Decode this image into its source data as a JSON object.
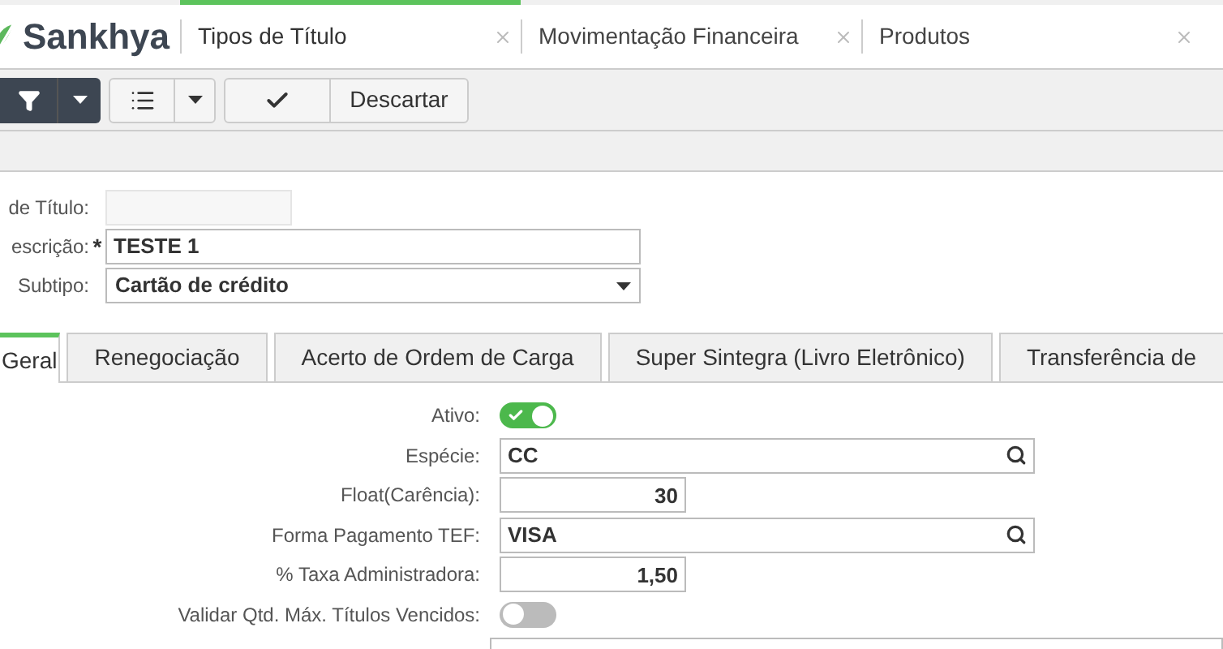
{
  "brand": "Sankhya",
  "tabs": [
    {
      "label": "Tipos de Título",
      "selected": true
    },
    {
      "label": "Movimentação Financeira",
      "selected": false
    },
    {
      "label": "Produtos",
      "selected": false
    }
  ],
  "toolbar": {
    "discard": "Descartar"
  },
  "header_fields": [
    {
      "label": "de Título:",
      "kind": "readonly"
    },
    {
      "label": "escrição:",
      "kind": "text",
      "value": "TESTE 1",
      "required_mark": "*"
    },
    {
      "label": "Subtipo:",
      "kind": "select",
      "value": "Cartão de crédito"
    }
  ],
  "form_tabs": [
    {
      "label": "Geral",
      "selected": true
    },
    {
      "label": "Renegociação",
      "selected": false
    },
    {
      "label": "Acerto de Ordem de Carga",
      "selected": false
    },
    {
      "label": "Super Sintegra (Livro Eletrônico)",
      "selected": false
    },
    {
      "label": "Transferência de",
      "selected": false
    }
  ],
  "fields": [
    {
      "label": "Ativo:",
      "kind": "toggle",
      "on": true
    },
    {
      "label": "Espécie:",
      "kind": "lookup",
      "value": "CC"
    },
    {
      "label": "Float(Carência):",
      "kind": "number",
      "value": "30"
    },
    {
      "label": "Forma Pagamento TEF:",
      "kind": "lookup",
      "value": "VISA"
    },
    {
      "label": "% Taxa Administradora:",
      "kind": "number",
      "value": "1,50"
    },
    {
      "label": "Validar Qtd. Máx. Títulos Vencidos:",
      "kind": "toggle",
      "on": false
    }
  ]
}
